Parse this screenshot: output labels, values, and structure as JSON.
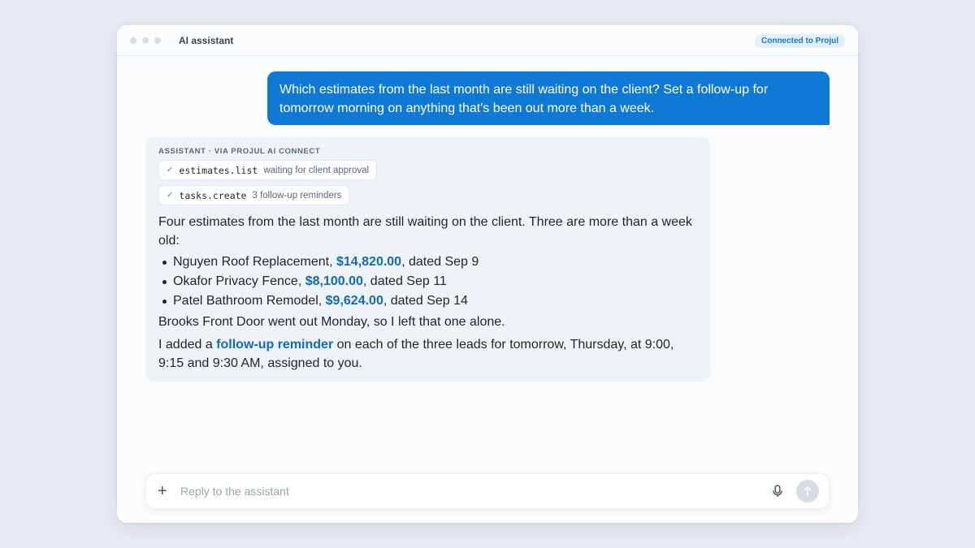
{
  "window": {
    "title": "AI assistant",
    "connection_badge": "Connected to Projul"
  },
  "user_message": {
    "text": "Which estimates from the last month are still waiting on the client? Set a follow-up for tomorrow morning on anything that's been out more than a week."
  },
  "assistant": {
    "label": "ASSISTANT · VIA PROJUL AI CONNECT",
    "tool_calls": [
      {
        "name": "estimates.list",
        "description": "waiting for client approval",
        "status": "done"
      },
      {
        "name": "tasks.create",
        "description": "3 follow-up reminders",
        "status": "done"
      }
    ],
    "intro": "Four estimates from the last month are still waiting on the client. Three are more than a week old:",
    "estimates": [
      {
        "name": "Nguyen Roof Replacement, ",
        "amount": "$14,820.00",
        "date": ", dated Sep 9"
      },
      {
        "name": "Okafor Privacy Fence, ",
        "amount": "$8,100.00",
        "date": ", dated Sep 11"
      },
      {
        "name": "Patel Bathroom Remodel, ",
        "amount": "$9,624.00",
        "date": ", dated Sep 14"
      }
    ],
    "note": "Brooks Front Door went out Monday, so I left that one alone.",
    "followup_prefix": "I added a ",
    "followup_link": "follow-up reminder",
    "followup_suffix": " on each of the three leads for tomorrow, Thursday, at 9:00, 9:15 and 9:30 AM, assigned to you."
  },
  "composer": {
    "placeholder": "Reply to the assistant",
    "value": ""
  },
  "colors": {
    "accent": "#0f7ad6",
    "link": "#1369b5",
    "check": "#2f9e6b"
  },
  "icons": {
    "plus": "plus-icon",
    "mic": "microphone-icon",
    "send": "send-arrow-icon",
    "check": "check-icon"
  }
}
